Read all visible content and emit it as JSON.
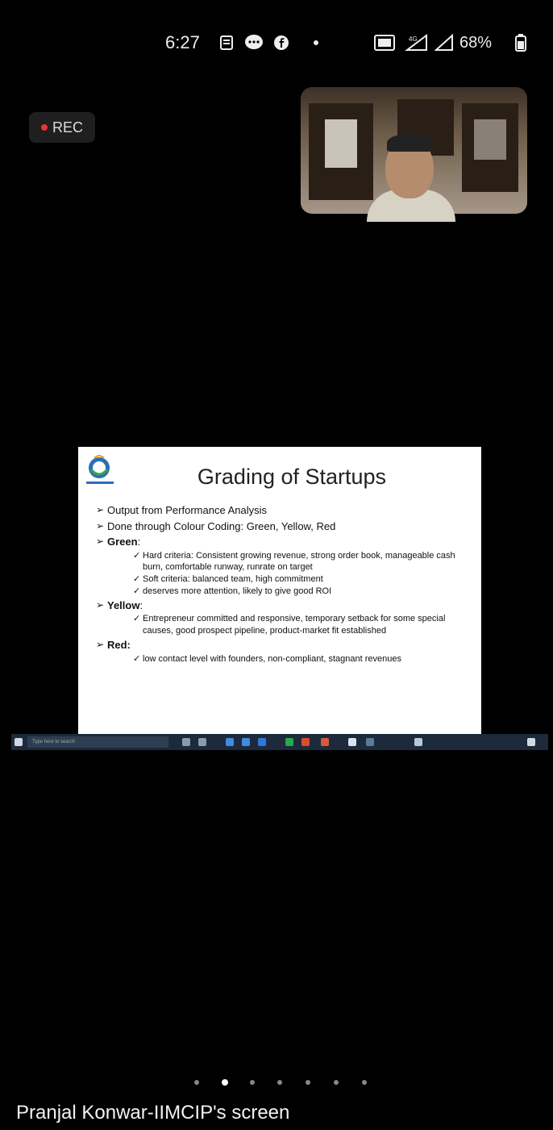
{
  "status_bar": {
    "time": "6:27",
    "battery": "68%"
  },
  "recording": {
    "label": "REC"
  },
  "slide": {
    "title": "Grading of Startups",
    "bullets": [
      "Output from Performance Analysis",
      "Done through Colour Coding: Green, Yellow, Red"
    ],
    "green": {
      "label": "Green",
      "suffix": ":",
      "items": [
        "Hard criteria: Consistent growing revenue, strong order book, manageable cash burn, comfortable runway, runrate on target",
        "Soft criteria: balanced team, high commitment",
        "deserves more attention, likely to give good ROI"
      ]
    },
    "yellow": {
      "label": "Yellow",
      "suffix": ":",
      "items": [
        "Entrepreneur committed and responsive, temporary setback for some special causes, good prospect pipeline, product-market fit established"
      ]
    },
    "red": {
      "label": "Red:",
      "items": [
        "low contact level with founders, non-compliant, stagnant revenues"
      ]
    }
  },
  "taskbar": {
    "search_placeholder": "Type here to search"
  },
  "pager": {
    "count": 7,
    "active_index": 1
  },
  "screen_label": "Pranjal Konwar-IIMCIP's screen",
  "colors": {
    "rec_dot": "#e33333",
    "background": "#000000"
  }
}
